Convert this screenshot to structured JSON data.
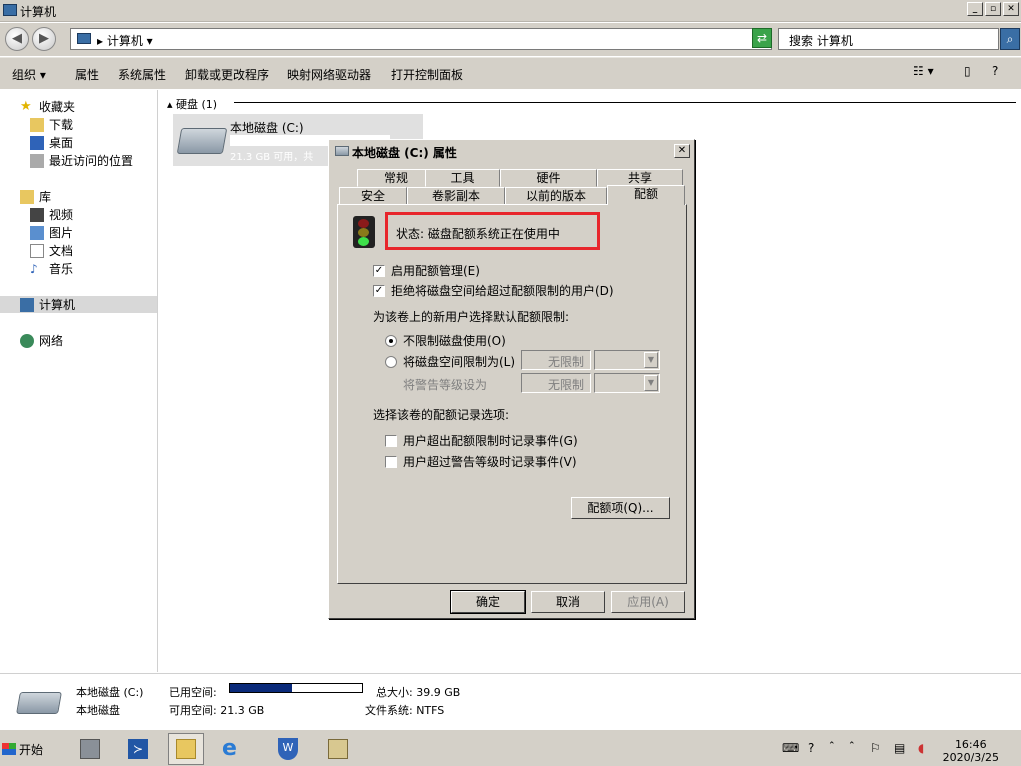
{
  "window": {
    "title": "计算机"
  },
  "address": {
    "crumb": "▸ 计算机 ▾",
    "search_placeholder": "搜索 计算机"
  },
  "toolbar": {
    "items": [
      "组织 ▾",
      "属性",
      "系统属性",
      "卸载或更改程序",
      "映射网络驱动器",
      "打开控制面板"
    ]
  },
  "nav": {
    "favorites": "收藏夹",
    "downloads": "下载",
    "desktop": "桌面",
    "recent": "最近访问的位置",
    "libraries": "库",
    "videos": "视频",
    "pictures": "图片",
    "documents": "文档",
    "music": "音乐",
    "computer": "计算机",
    "network": "网络"
  },
  "main": {
    "group_header": "▴ 硬盘 (1)",
    "drive_name": "本地磁盘 (C:)",
    "drive_free": "21.3 GB 可用，共"
  },
  "details": {
    "line1_name": "本地磁盘 (C:)",
    "used_label": "已用空间:",
    "used_fraction": 0.47,
    "total": "总大小: 39.9 GB",
    "line2_name": "本地磁盘",
    "free": "可用空间: 21.3 GB",
    "fs": "文件系统: NTFS"
  },
  "dialog": {
    "title": "本地磁盘 (C:) 属性",
    "close": "✕",
    "tabs_top": [
      "常规",
      "工具",
      "硬件",
      "共享"
    ],
    "tabs_bottom": [
      "安全",
      "卷影副本",
      "以前的版本",
      "配额"
    ],
    "status": "状态:  磁盘配额系统正在使用中",
    "enable_quota": "启用配额管理(E)",
    "deny_space": "拒绝将磁盘空间给超过配额限制的用户(D)",
    "default_limit_heading": "为该卷上的新用户选择默认配额限制:",
    "no_limit": "不限制磁盘使用(O)",
    "limit_to": "将磁盘空间限制为(L)",
    "warn_level": "将警告等级设为",
    "unlimited": "无限制",
    "log_heading": "选择该卷的配额记录选项:",
    "log_exceed_limit": "用户超出配额限制时记录事件(G)",
    "log_exceed_warn": "用户超过警告等级时记录事件(V)",
    "quota_entries": "配额项(Q)...",
    "ok": "确定",
    "cancel": "取消",
    "apply": "应用(A)"
  },
  "taskbar": {
    "start": "开始",
    "time": "16:46",
    "date": "2020/3/25"
  }
}
